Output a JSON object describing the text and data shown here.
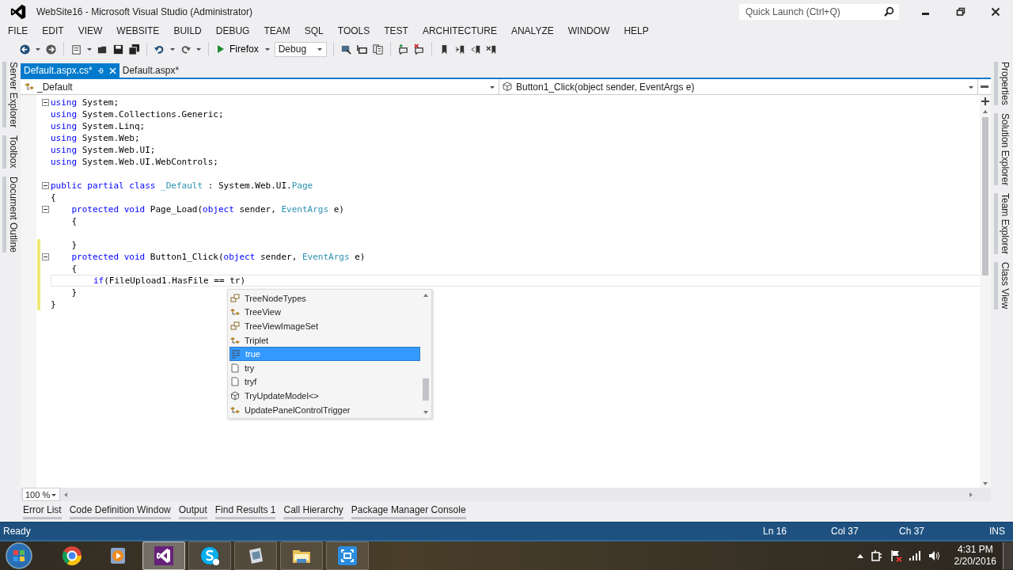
{
  "window": {
    "title": "WebSite16 - Microsoft Visual Studio (Administrator)",
    "quick_launch": {
      "placeholder": "Quick Launch (Ctrl+Q)"
    }
  },
  "menu": [
    "FILE",
    "EDIT",
    "VIEW",
    "WEBSITE",
    "BUILD",
    "DEBUG",
    "TEAM",
    "SQL",
    "TOOLS",
    "TEST",
    "ARCHITECTURE",
    "ANALYZE",
    "WINDOW",
    "HELP"
  ],
  "toolbar": {
    "run_target": "Firefox",
    "configuration": "Debug"
  },
  "side_tabs_left": [
    "Server Explorer",
    "Toolbox",
    "Document Outline"
  ],
  "document_tabs": [
    {
      "label": "Default.aspx.cs*",
      "selected": true
    },
    {
      "label": "Default.aspx*",
      "selected": false
    }
  ],
  "navigation": {
    "type": "_Default",
    "member": "Button1_Click(object sender, EventArgs e)"
  },
  "code_lines": [
    {
      "fold": true,
      "changed": false,
      "current": false,
      "tokens": [
        {
          "kind": "keyword",
          "text": "using"
        },
        {
          "kind": "plain",
          "text": " System;"
        }
      ]
    },
    {
      "fold": false,
      "changed": false,
      "current": false,
      "tokens": [
        {
          "kind": "keyword",
          "text": "using"
        },
        {
          "kind": "plain",
          "text": " System.Collections.Generic;"
        }
      ]
    },
    {
      "fold": false,
      "changed": false,
      "current": false,
      "tokens": [
        {
          "kind": "keyword",
          "text": "using"
        },
        {
          "kind": "plain",
          "text": " System.Linq;"
        }
      ]
    },
    {
      "fold": false,
      "changed": false,
      "current": false,
      "tokens": [
        {
          "kind": "keyword",
          "text": "using"
        },
        {
          "kind": "plain",
          "text": " System.Web;"
        }
      ]
    },
    {
      "fold": false,
      "changed": false,
      "current": false,
      "tokens": [
        {
          "kind": "keyword",
          "text": "using"
        },
        {
          "kind": "plain",
          "text": " System.Web.UI;"
        }
      ]
    },
    {
      "fold": false,
      "changed": false,
      "current": false,
      "tokens": [
        {
          "kind": "keyword",
          "text": "using"
        },
        {
          "kind": "plain",
          "text": " System.Web.UI.WebControls;"
        }
      ]
    },
    {
      "fold": false,
      "changed": false,
      "current": false
    },
    {
      "fold": true,
      "changed": false,
      "current": false,
      "tokens": [
        {
          "kind": "keyword",
          "text": "public partial class "
        },
        {
          "kind": "type",
          "text": "_Default"
        },
        {
          "kind": "plain",
          "text": " : System.Web.UI."
        },
        {
          "kind": "type",
          "text": "Page"
        }
      ]
    },
    {
      "fold": false,
      "changed": false,
      "current": false,
      "tokens": [
        {
          "kind": "plain",
          "text": "{"
        }
      ]
    },
    {
      "fold": true,
      "changed": false,
      "current": false,
      "tokens": [
        {
          "kind": "keyword",
          "text": "    protected void"
        },
        {
          "kind": "plain",
          "text": " Page_Load("
        },
        {
          "kind": "keyword",
          "text": "object"
        },
        {
          "kind": "plain",
          "text": " sender, "
        },
        {
          "kind": "type",
          "text": "EventArgs"
        },
        {
          "kind": "plain",
          "text": " e)"
        }
      ]
    },
    {
      "fold": false,
      "changed": false,
      "current": false,
      "tokens": [
        {
          "kind": "plain",
          "text": "    {"
        }
      ]
    },
    {
      "fold": false,
      "changed": false,
      "current": false
    },
    {
      "fold": false,
      "changed": true,
      "current": false,
      "tokens": [
        {
          "kind": "plain",
          "text": "    }"
        }
      ]
    },
    {
      "fold": true,
      "changed": true,
      "current": false,
      "tokens": [
        {
          "kind": "keyword",
          "text": "    protected void"
        },
        {
          "kind": "plain",
          "text": " Button1_Click("
        },
        {
          "kind": "keyword",
          "text": "object"
        },
        {
          "kind": "plain",
          "text": " sender, "
        },
        {
          "kind": "type",
          "text": "EventArgs"
        },
        {
          "kind": "plain",
          "text": " e)"
        }
      ]
    },
    {
      "fold": false,
      "changed": true,
      "current": false,
      "tokens": [
        {
          "kind": "plain",
          "text": "    {"
        }
      ]
    },
    {
      "fold": false,
      "changed": true,
      "current": true,
      "tokens": [
        {
          "kind": "keyword",
          "text": "        if"
        },
        {
          "kind": "plain",
          "text": "(FileUpload1.HasFile == tr)"
        }
      ]
    },
    {
      "fold": false,
      "changed": true,
      "current": false,
      "tokens": [
        {
          "kind": "plain",
          "text": "    }"
        }
      ]
    },
    {
      "fold": false,
      "changed": true,
      "current": false,
      "tokens": [
        {
          "kind": "plain",
          "text": "}"
        }
      ]
    }
  ],
  "completion": [
    {
      "kind": "enum",
      "label": "TreeNodeTypes",
      "selected": false
    },
    {
      "kind": "class",
      "label": "TreeView",
      "selected": false
    },
    {
      "kind": "enum",
      "label": "TreeViewImageSet",
      "selected": false
    },
    {
      "kind": "class",
      "label": "Triplet",
      "selected": false
    },
    {
      "kind": "keyword",
      "label": "true",
      "selected": true
    },
    {
      "kind": "snippet",
      "label": "try",
      "selected": false
    },
    {
      "kind": "snippet",
      "label": "tryf",
      "selected": false
    },
    {
      "kind": "method",
      "label": "TryUpdateModel<>",
      "selected": false
    },
    {
      "kind": "class",
      "label": "UpdatePanelControlTrigger",
      "selected": false
    }
  ],
  "zoom": "100 %",
  "side_tabs_right": [
    "Properties",
    "Solution Explorer",
    "Team Explorer",
    "Class View"
  ],
  "tool_tabs": [
    "Error List",
    "Code Definition Window",
    "Output",
    "Find Results 1",
    "Call Hierarchy",
    "Package Manager Console"
  ],
  "status_bar": {
    "message": "Ready",
    "line": "Ln 16",
    "column": "Col 37",
    "char": "Ch 37",
    "mode": "INS"
  },
  "taskbar": {
    "apps": [
      {
        "kind": "browser",
        "active": false
      },
      {
        "kind": "media",
        "active": false
      },
      {
        "kind": "studio",
        "active": true
      },
      {
        "kind": "chat",
        "active": false
      },
      {
        "kind": "notes",
        "active": false
      },
      {
        "kind": "folder",
        "active": false
      },
      {
        "kind": "capture",
        "active": false
      }
    ],
    "time": "4:31 PM",
    "date": "2/20/2016"
  }
}
